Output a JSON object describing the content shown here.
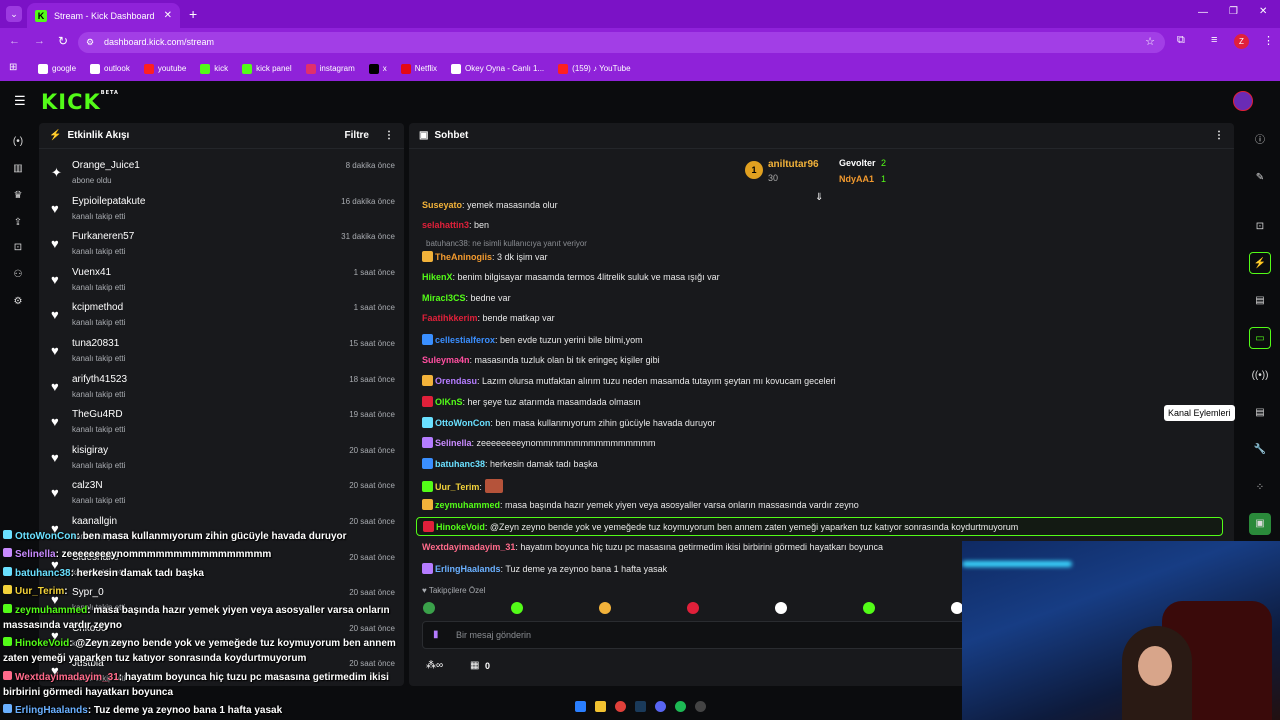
{
  "browser": {
    "tab_title": "Stream - Kick Dashboard",
    "url": "dashboard.kick.com/stream",
    "profile_initial": "Z",
    "bookmarks": [
      {
        "label": "google",
        "color": "#ffffff"
      },
      {
        "label": "outlook",
        "color": "#ffffff"
      },
      {
        "label": "youtube",
        "color": "#ff2020"
      },
      {
        "label": "kick",
        "color": "#53fc18"
      },
      {
        "label": "kick panel",
        "color": "#53fc18"
      },
      {
        "label": "instagram",
        "color": "#e1306c"
      },
      {
        "label": "x",
        "color": "#000000"
      },
      {
        "label": "Netflix",
        "color": "#e50914"
      },
      {
        "label": "Okey Oyna - Canlı 1...",
        "color": "#ffffff"
      },
      {
        "label": "(159) ♪ YouTube",
        "color": "#ff2020"
      }
    ]
  },
  "header": {
    "logo": "KICK",
    "logo_badge": "BETA"
  },
  "activity": {
    "title": "Etkinlik Akışı",
    "filter_label": "Filtre",
    "items": [
      {
        "name": "Orange_Juice1",
        "action": "abone oldu",
        "time": "8 dakika önce",
        "icon": "sparkle-icon"
      },
      {
        "name": "Eypioilepatakute",
        "action": "kanalı takip etti",
        "time": "16 dakika önce",
        "icon": "heart-icon"
      },
      {
        "name": "Furkaneren57",
        "action": "kanalı takip etti",
        "time": "31 dakika önce",
        "icon": "heart-icon"
      },
      {
        "name": "Vuenx41",
        "action": "kanalı takip etti",
        "time": "1 saat önce",
        "icon": "heart-icon"
      },
      {
        "name": "kcipmethod",
        "action": "kanalı takip etti",
        "time": "1 saat önce",
        "icon": "heart-icon"
      },
      {
        "name": "tuna20831",
        "action": "kanalı takip etti",
        "time": "15 saat önce",
        "icon": "heart-icon"
      },
      {
        "name": "arifyth41523",
        "action": "kanalı takip etti",
        "time": "18 saat önce",
        "icon": "heart-icon"
      },
      {
        "name": "TheGu4RD",
        "action": "kanalı takip etti",
        "time": "19 saat önce",
        "icon": "heart-icon"
      },
      {
        "name": "kisigiray",
        "action": "kanalı takip etti",
        "time": "20 saat önce",
        "icon": "heart-icon"
      },
      {
        "name": "calz3N",
        "action": "kanalı takip etti",
        "time": "20 saat önce",
        "icon": "heart-icon"
      },
      {
        "name": "kaanallgin",
        "action": "kanalı takip etti",
        "time": "20 saat önce",
        "icon": "heart-icon"
      },
      {
        "name": "Sideshake",
        "action": "kanalı takip etti",
        "time": "20 saat önce",
        "icon": "heart-icon"
      },
      {
        "name": "Sypr_0",
        "action": "kanalı takip etti",
        "time": "20 saat önce",
        "icon": "heart-icon"
      },
      {
        "name": "Crikoo0",
        "action": "kanalı takip etti",
        "time": "20 saat önce",
        "icon": "heart-icon"
      },
      {
        "name": "Justbia",
        "action": "kanalı takip etti",
        "time": "20 saat önce",
        "icon": "heart-icon"
      }
    ]
  },
  "chat": {
    "title": "Sohbet",
    "leaderboard": [
      {
        "rank": "1",
        "name": "aniltutar96",
        "count": "30"
      },
      {
        "name": "Gevolter",
        "count": "2"
      },
      {
        "name": "NdyAA1",
        "count": "1"
      }
    ],
    "reply_note": "batuhanc38: ne isimli kullanıcıya yanıt veriyor",
    "messages": [
      {
        "user": "Suseyato",
        "color": "#f2b23a",
        "text": ": yemek masasında olur"
      },
      {
        "user": "selahattin3",
        "color": "#e0203a",
        "text": ": ben"
      },
      {
        "user": "TheAninogiis",
        "color": "#f29a2e",
        "text": ": 3 dk işim var"
      },
      {
        "user": "HikenX",
        "color": "#53fc18",
        "text": ": benim bilgisayar masamda termos 4litrelik suluk ve masa ışığı var"
      },
      {
        "user": "Miracl3CS",
        "color": "#53fc18",
        "text": ": bedne var"
      },
      {
        "user": "Faatihkkerim",
        "color": "#e0203a",
        "text": ": bende matkap var"
      },
      {
        "user": "cellestialferox",
        "color": "#3b8fff",
        "text": ": ben evde tuzun yerini bile bilmi,yom"
      },
      {
        "user": "Suleyma4n",
        "color": "#ff4fa0",
        "text": ": masasında tuzluk olan bi tık eringeç kişiler gibi"
      },
      {
        "user": "Orendasu",
        "color": "#b57cff",
        "text": ": Lazım olursa mutfaktan alırım tuzu neden masamda tutayım şeytan mı kovucam geceleri"
      },
      {
        "user": "OlKnS",
        "color": "#53fc18",
        "text": ": her şeye tuz atarımda masamdada olmasın"
      },
      {
        "user": "OttoWonCon",
        "color": "#6ae0ff",
        "text": ": ben masa kullanmıyorum zihin gücüyle havada duruyor"
      },
      {
        "user": "Selinella",
        "color": "#c98bff",
        "text": ": zeeeeeeeeynommmmmmmmmmmmmmmm"
      },
      {
        "user": "batuhanc38",
        "color": "#6ae0ff",
        "text": ": herkesin damak tadı başka"
      },
      {
        "user": "Uur_Terim",
        "color": "#f2d23a",
        "text": ":"
      },
      {
        "user": "zeymuhammed",
        "color": "#53fc18",
        "text": ": masa başında hazır yemek yiyen veya asosyaller varsa onların massasında vardır zeyno"
      },
      {
        "user": "HinokeVoid",
        "color": "#53fc18",
        "text": ": @Zeyn zeyno bende yok ve yemeğede tuz koymuyorum ben annem zaten yemeği yaparken tuz katıyor sonrasında koydurtmuyorum"
      },
      {
        "user": "Wextdayimadayim_31",
        "color": "#ff6b8b",
        "text": ": hayatım boyunca hiç tuzu pc masasına getirmedim ikisi birbirini görmedi hayatkarı boyunca"
      },
      {
        "user": "ErlingHaalands",
        "color": "#6ab0ff",
        "text": ": Tuz deme ya zeynoo bana 1 hafta yasak"
      }
    ],
    "followers_only_label": "Takipçilere Özel",
    "input_placeholder": "Bir mesaj gönderin",
    "points_count": "0"
  },
  "right_rail": {
    "tooltip": "Kanal Eylemleri"
  },
  "overlay": {
    "lines": [
      {
        "user": "OttoWonCon",
        "color": "#6ae0ff",
        "text": ": ben masa kullanmıyorum zihin gücüyle havada duruyor"
      },
      {
        "user": "Selinella",
        "color": "#c98bff",
        "text": ": zeeeeeeeeynommmmmmmmmmmmmmmm"
      },
      {
        "user": "batuhanc38",
        "color": "#6ae0ff",
        "text": ": herkesin damak tadı başka"
      },
      {
        "user": "Uur_Terim",
        "color": "#f2d23a",
        "text": ":"
      },
      {
        "user": "zeymuhammed",
        "color": "#53fc18",
        "text": ": masa başında hazır yemek yiyen veya asosyaller varsa onların"
      },
      {
        "user": "",
        "color": "#ffffff",
        "text": "massasında vardır zeyno"
      },
      {
        "user": "HinokeVoid",
        "color": "#53fc18",
        "text": ": @Zeyn zeyno bende yok ve yemeğede tuz koymuyorum ben annem"
      },
      {
        "user": "",
        "color": "#ffffff",
        "text": "zaten yemeği yaparken tuz katıyor sonrasında koydurtmuyorum"
      },
      {
        "user": "Wextdayimadayim_31",
        "color": "#ff6b8b",
        "text": ": hayatım boyunca hiç tuzu pc masasına getirmedim ikisi"
      },
      {
        "user": "",
        "color": "#ffffff",
        "text": "birbirini görmedi hayatkarı boyunca"
      },
      {
        "user": "ErlingHaalands",
        "color": "#6ab0ff",
        "text": ": Tuz deme ya zeynoo bana 1 hafta yasak"
      }
    ]
  }
}
